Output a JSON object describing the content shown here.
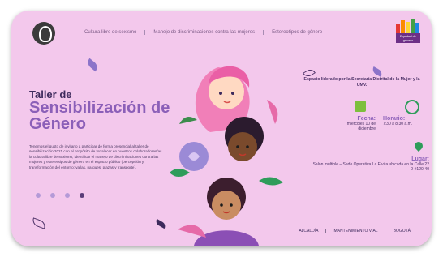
{
  "nav": {
    "items": [
      "Cultura libre de sexismo",
      "Manejo de discriminaciones contra las mujeres",
      "Estereotipos de género"
    ]
  },
  "brand": {
    "text": "Equidad de género",
    "colors": [
      "#e53935",
      "#fb8c00",
      "#fdd835",
      "#43a047",
      "#1e88e5",
      "#8e24aa"
    ]
  },
  "hero": {
    "title_top": "Taller de",
    "title_main": "Sensibilización de Género",
    "description": "Tenemos el gusto de invitarlo a participar de forma presencial al taller de sensibilización 2021 con el propósito de fortalecer en nuestros colaboradores/as la cultura libre de sexismo, identificar el manejo de discriminaciones contra las mujeres y estereotipos de género en el espacio público (percepción y transformación del entorno: vallas, parques, plazas y transporte)."
  },
  "carousel": {
    "dots": 4,
    "active": 3
  },
  "event": {
    "venue": "Espacio liderado por la Secretaría Distrital de la Mujer y la UMV.",
    "date_label": "Fecha:",
    "date_value": "miércoles 10 de diciembre",
    "time_label": "Horario:",
    "time_value": "7:30 a 8:30 a.m.",
    "place_label": "Lugar:",
    "place_value": "Salón múltiple – Sede Operativa La Elvira ubicada en la Calle 22 D #120-40"
  },
  "footer": {
    "items": [
      "ALCALDÍA",
      "MANTENIMIENTO VIAL",
      "BOGOTÁ"
    ]
  }
}
